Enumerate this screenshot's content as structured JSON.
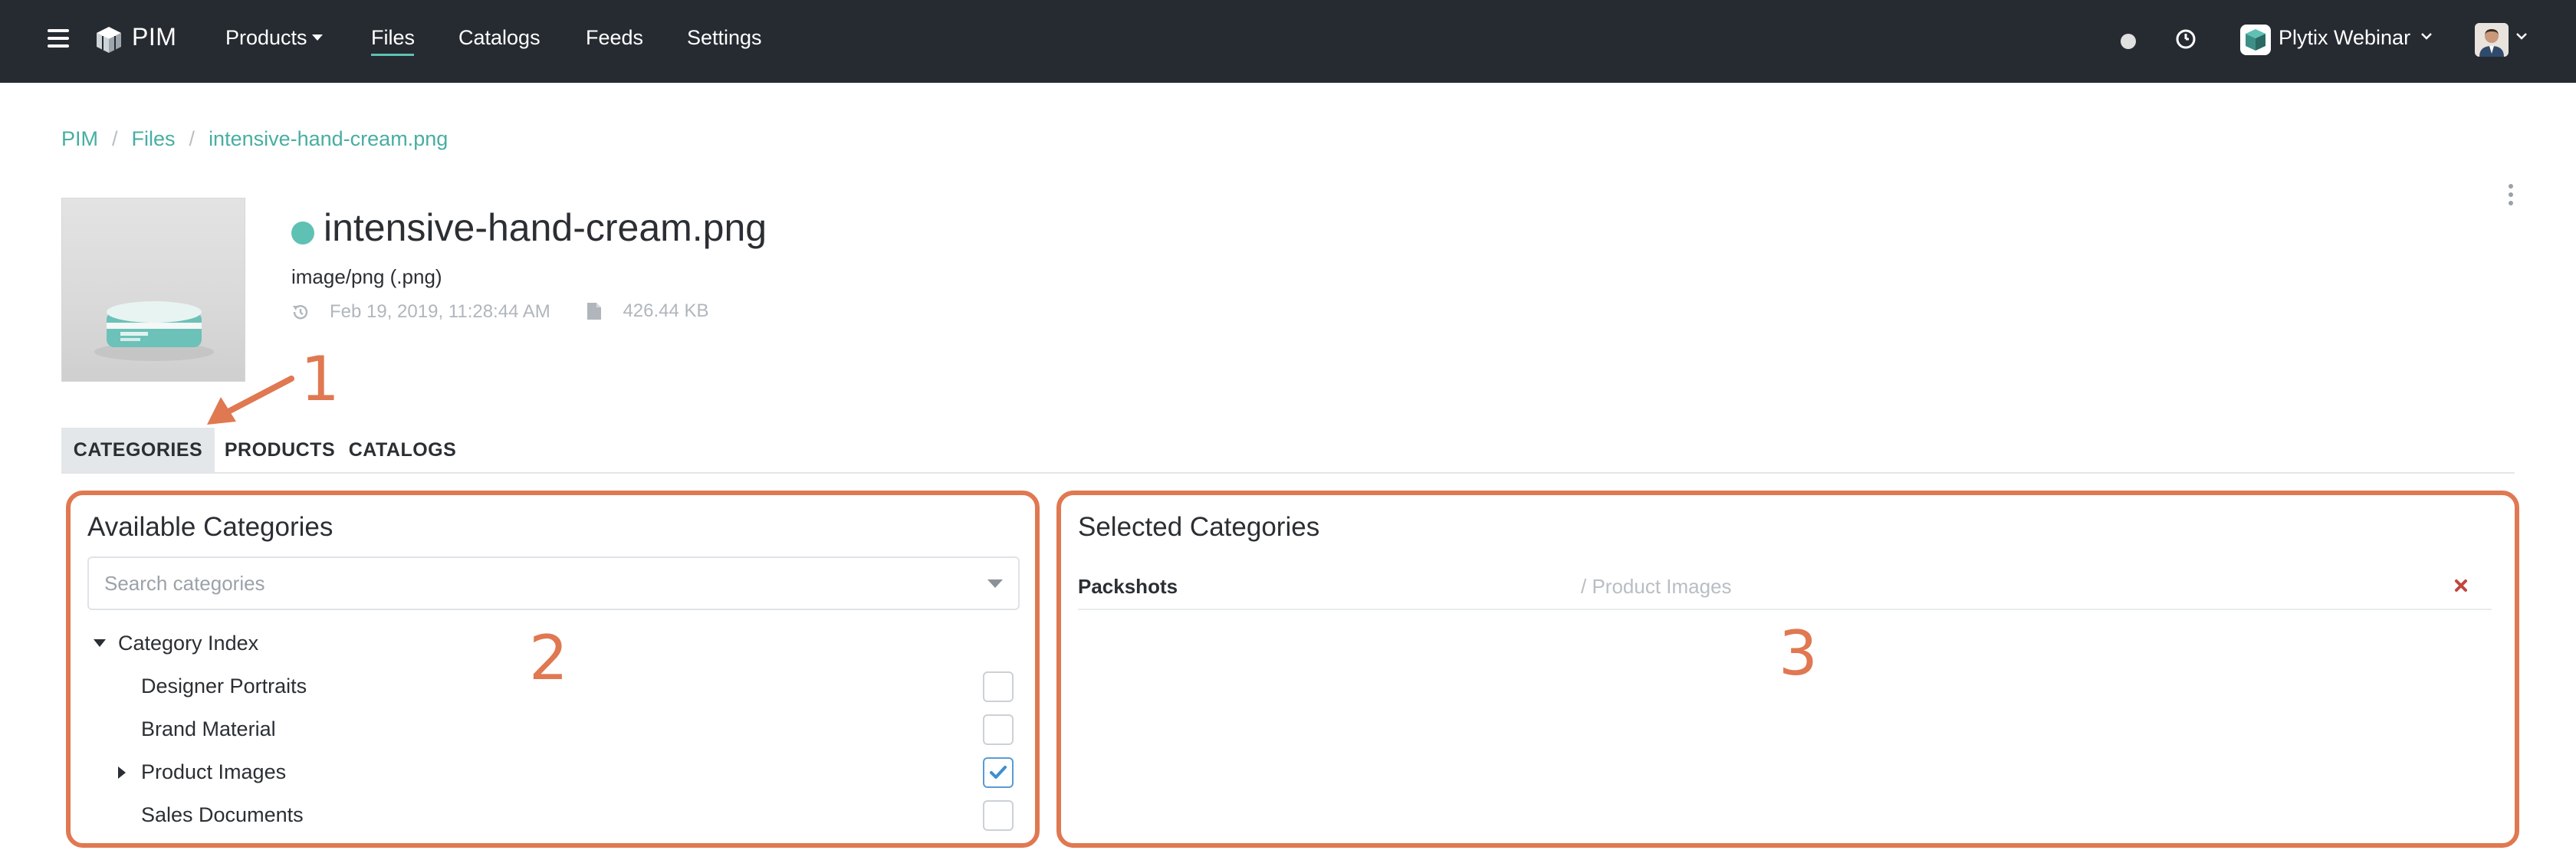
{
  "nav": {
    "logo": "PIM",
    "items": [
      {
        "label": "Products",
        "has_caret": true
      },
      {
        "label": "Files",
        "active": true
      },
      {
        "label": "Catalogs"
      },
      {
        "label": "Feeds"
      },
      {
        "label": "Settings"
      }
    ],
    "org_label": "Plytix Webinar",
    "accent_color": "#5fc1b4",
    "bar_color": "#262b31"
  },
  "breadcrumb": {
    "items": [
      "PIM",
      "Files",
      "intensive-hand-cream.png"
    ]
  },
  "file": {
    "name": "intensive-hand-cream.png",
    "mimetype": "image/png (.png)",
    "timestamp": "Feb 19, 2019, 11:28:44 AM",
    "size": "426.44 KB",
    "status_color": "#5fc1b4"
  },
  "tabs": [
    {
      "label": "CATEGORIES",
      "active": true
    },
    {
      "label": "PRODUCTS"
    },
    {
      "label": "CATALOGS"
    }
  ],
  "annotations": {
    "one": "1",
    "two": "2",
    "three": "3",
    "color": "#e07851"
  },
  "available": {
    "title": "Available Categories",
    "search_placeholder": "Search categories",
    "root": "Category Index",
    "items": [
      {
        "label": "Designer Portraits",
        "checked": false,
        "has_children": false
      },
      {
        "label": "Brand Material",
        "checked": false,
        "has_children": false
      },
      {
        "label": "Product Images",
        "checked": true,
        "has_children": true
      },
      {
        "label": "Sales Documents",
        "checked": false,
        "has_children": false
      }
    ]
  },
  "selected": {
    "title": "Selected Categories",
    "items": [
      {
        "name": "Packshots",
        "path": "/ Product Images"
      }
    ]
  }
}
